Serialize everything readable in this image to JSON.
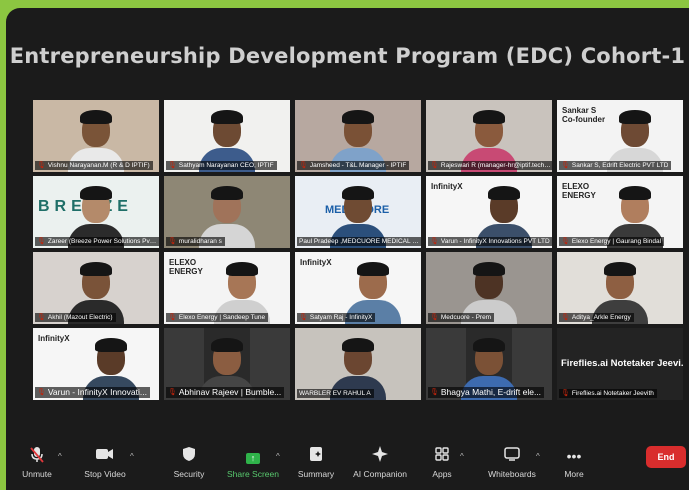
{
  "meeting": {
    "title": "Entrepreneurship Development Program (EDC) Cohort-1"
  },
  "tiles": [
    {
      "name": "Vishnu Narayanan.M (R & D IPTIF)",
      "muted": true,
      "bg": "#c9b8a5",
      "skin": "#7a5438",
      "shirt": "#e9e9e9"
    },
    {
      "name": "Sathyam Narayanan CEO, IPTIF",
      "muted": true,
      "bg": "#f1f1ef",
      "skin": "#6d4a33",
      "shirt": "#3d5c8c"
    },
    {
      "name": "Jamsheed - T&L Manager - IPTIF",
      "muted": true,
      "bg": "#b7a8a0",
      "skin": "#7a5136",
      "shirt": "#7fa2c9"
    },
    {
      "name": "Rajeswari R (manager-hr@iptif.tech (IPTIF)",
      "muted": true,
      "bg": "#c9c3bd",
      "skin": "#8a5a3d",
      "shirt": "#c84a74"
    },
    {
      "name": "Sankar S, Edrift Electric PVT LTD",
      "muted": true,
      "bg": "#f3f3f3",
      "skin": "#6e4a34",
      "shirt": "#d7d7d7",
      "logo": "Sankar S\nCo-founder"
    },
    {
      "name": "Zareer (Breeze Power Solutions Pvt Ltd)",
      "muted": true,
      "bg": "#ebf1ef",
      "skin": "#b48a6a",
      "shirt": "#2b2b2b",
      "logo": "BREEZE"
    },
    {
      "name": "muralidharan s",
      "muted": true,
      "bg": "#8e8775",
      "skin": "#a0735a",
      "shirt": "#d5d5d5",
      "active": true
    },
    {
      "name": "Paul Pradeep ,MEDCUORE MEDICAL SOLUTI...",
      "muted": false,
      "bg": "#e9eef4",
      "skin": "#6f4b33",
      "shirt": "#2b4f7b",
      "logo": "MEDCUORE"
    },
    {
      "name": "Varun - InfinityX Innovations PVT LTD",
      "muted": true,
      "bg": "#f6f6f6",
      "skin": "#5a3b28",
      "shirt": "#3b4f6a",
      "logo": "InfinityX"
    },
    {
      "name": "Elexo Energy | Gaurang Bindal",
      "muted": true,
      "bg": "#f4f4f4",
      "skin": "#b07e5e",
      "shirt": "#3a3a3a",
      "logo": "ELEXO\nENERGY"
    },
    {
      "name": "Akhil (Mazout Electric)",
      "muted": true,
      "bg": "#d7d2ce",
      "skin": "#7a5339",
      "shirt": "#2a2a2a"
    },
    {
      "name": "Elexo Energy | Sandeep Tune",
      "muted": true,
      "bg": "#f4f4f4",
      "skin": "#a77656",
      "shirt": "#cfcfcf",
      "logo": "ELEXO\nENERGY"
    },
    {
      "name": "Satyam Raj - InfinityX",
      "muted": true,
      "bg": "#f6f6f6",
      "skin": "#9c6b4c",
      "shirt": "#5b7fa6",
      "logo": "InfinityX"
    },
    {
      "name": "Medcuore - Prem",
      "muted": true,
      "bg": "#9a9590",
      "skin": "#4d3324",
      "shirt": "#cccccc"
    },
    {
      "name": "Aditya_Arkle Energy",
      "muted": true,
      "bg": "#e1ded9",
      "skin": "#8e5f42",
      "shirt": "#3e3e3e"
    },
    {
      "name": "Varun - InfinityX Innovati...",
      "muted": true,
      "bg": "#f6f6f6",
      "skin": "#5a3b28",
      "shirt": "#36495f",
      "logo": "InfinityX",
      "big": true
    },
    {
      "name": "Abhinav Rajeev | Bumble...",
      "muted": true,
      "bg": "#2a2a2a",
      "skin": "#8b5d41",
      "shirt": "#454545",
      "big": true,
      "inset": true
    },
    {
      "name": "WARBLER EV RAHUL A",
      "muted": false,
      "bg": "#c7c3bd",
      "skin": "#6b4631",
      "shirt": "#2e3a4f"
    },
    {
      "name": "Bhagya Mathi, E-drift ele...",
      "muted": true,
      "bg": "#2a2a2a",
      "skin": "#7b5136",
      "shirt": "#3d6bb0",
      "big": true,
      "inset": true
    },
    {
      "name": "Fireflies.ai Notetaker Jeevith",
      "muted": true,
      "dark": true,
      "heading": "Fireflies.ai Notetaker Jeevi..."
    }
  ],
  "toolbar": {
    "unmute": "Unmute",
    "stop_video": "Stop Video",
    "security": "Security",
    "share_screen": "Share Screen",
    "summary": "Summary",
    "ai_companion": "AI Companion",
    "apps": "Apps",
    "whiteboards": "Whiteboards",
    "more": "More",
    "end": "End"
  },
  "colors": {
    "border_green": "#8cc641",
    "share_green": "#2fb34a",
    "end_red": "#d92d2d",
    "muted_red": "#e0383b"
  }
}
